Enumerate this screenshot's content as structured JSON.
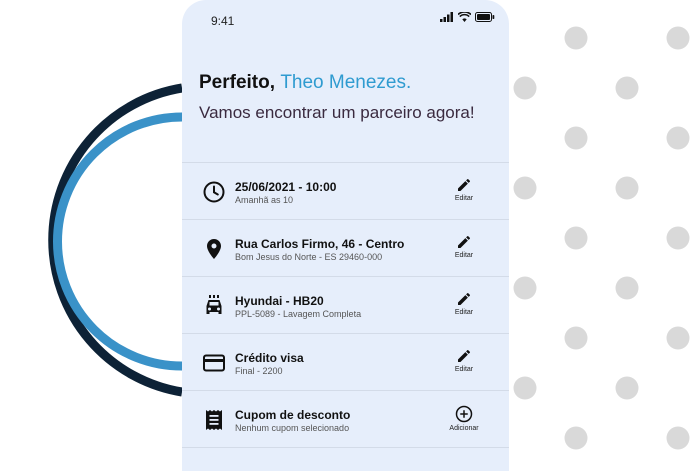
{
  "status_bar": {
    "time": "9:41"
  },
  "header": {
    "greeting": "Perfeito,",
    "name": "Theo Menezes.",
    "subtitle": "Vamos encontrar um parceiro agora!"
  },
  "items": [
    {
      "icon": "clock-icon",
      "title": "25/06/2021 - 10:00",
      "subtitle": "Amanhã as 10",
      "action": "Editar"
    },
    {
      "icon": "location-pin-icon",
      "title": "Rua Carlos Firmo, 46 -  Centro",
      "subtitle": "Bom Jesus do Norte - ES 29460-000",
      "action": "Editar"
    },
    {
      "icon": "car-icon",
      "title": "Hyundai - HB20",
      "subtitle": "PPL-5089 - Lavagem Completa",
      "action": "Editar"
    },
    {
      "icon": "credit-card-icon",
      "title": "Crédito visa",
      "subtitle": "Final - 2200",
      "action": "Editar"
    },
    {
      "icon": "receipt-icon",
      "title": "Cupom de desconto",
      "subtitle": "Nenhum cupom selecionado",
      "action": "Adicionar"
    }
  ],
  "colors": {
    "accent": "#2f9bd0",
    "panel": "#e6eefb",
    "arc_dark": "#0d2236",
    "arc_light": "#3a92c8",
    "dot": "#d9d9d9"
  }
}
